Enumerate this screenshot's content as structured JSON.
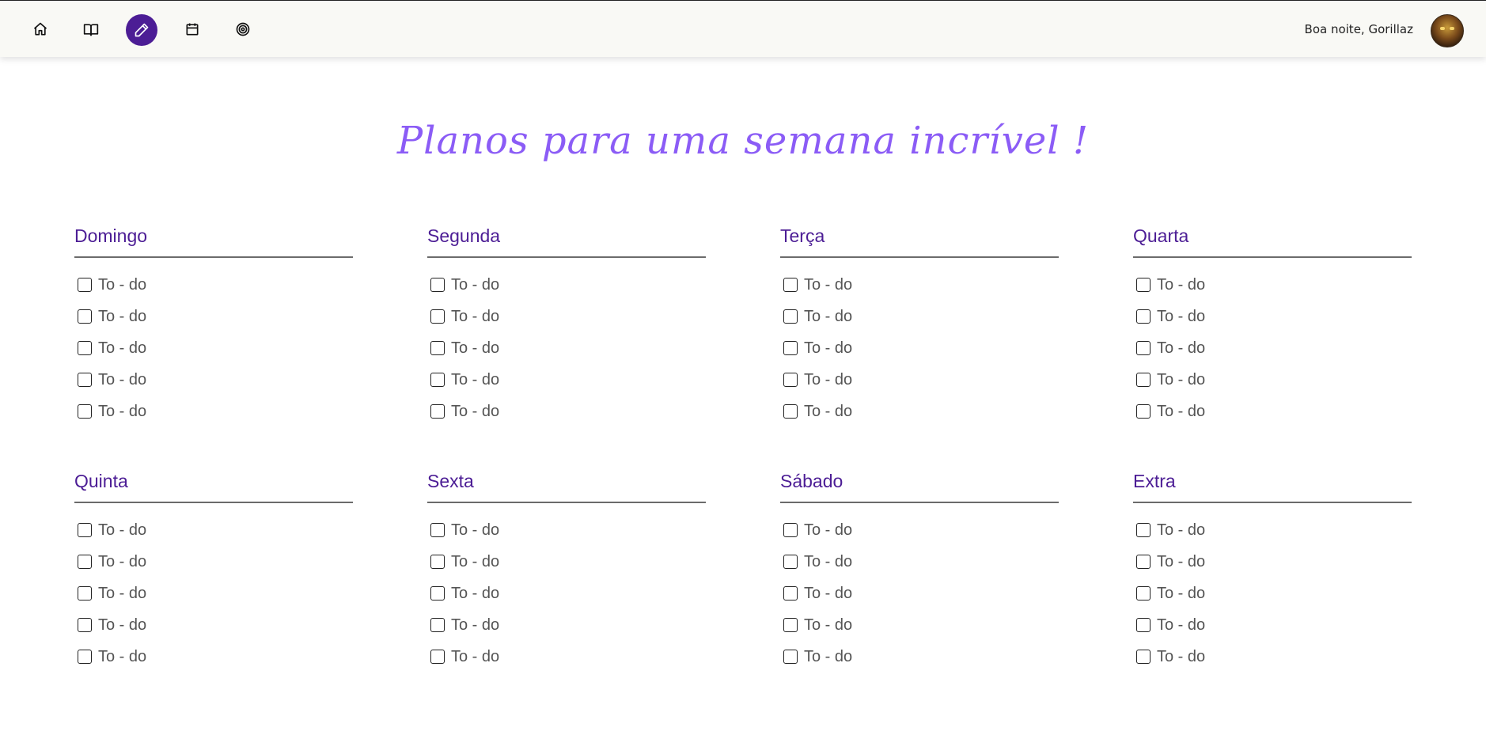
{
  "header": {
    "nav": [
      {
        "name": "home-icon"
      },
      {
        "name": "book-icon"
      },
      {
        "name": "pencil-icon"
      },
      {
        "name": "calendar-icon"
      },
      {
        "name": "target-icon"
      }
    ],
    "active_color": "#4c1d95",
    "greeting": "Boa noite, Gorillaz"
  },
  "main": {
    "title": "Planos para uma semana incrível !",
    "title_color": "#8b5cf6",
    "days": [
      {
        "title": "Domingo",
        "items": [
          "To - do",
          "To - do",
          "To - do",
          "To - do",
          "To - do"
        ]
      },
      {
        "title": "Segunda",
        "items": [
          "To - do",
          "To - do",
          "To - do",
          "To - do",
          "To - do"
        ]
      },
      {
        "title": "Terça",
        "items": [
          "To - do",
          "To - do",
          "To - do",
          "To - do",
          "To - do"
        ]
      },
      {
        "title": "Quarta",
        "items": [
          "To - do",
          "To - do",
          "To - do",
          "To - do",
          "To - do"
        ]
      },
      {
        "title": "Quinta",
        "items": [
          "To - do",
          "To - do",
          "To - do",
          "To - do",
          "To - do"
        ]
      },
      {
        "title": "Sexta",
        "items": [
          "To - do",
          "To - do",
          "To - do",
          "To - do",
          "To - do"
        ]
      },
      {
        "title": "Sábado",
        "items": [
          "To - do",
          "To - do",
          "To - do",
          "To - do",
          "To - do"
        ]
      },
      {
        "title": "Extra",
        "items": [
          "To - do",
          "To - do",
          "To - do",
          "To - do",
          "To - do"
        ]
      }
    ]
  }
}
